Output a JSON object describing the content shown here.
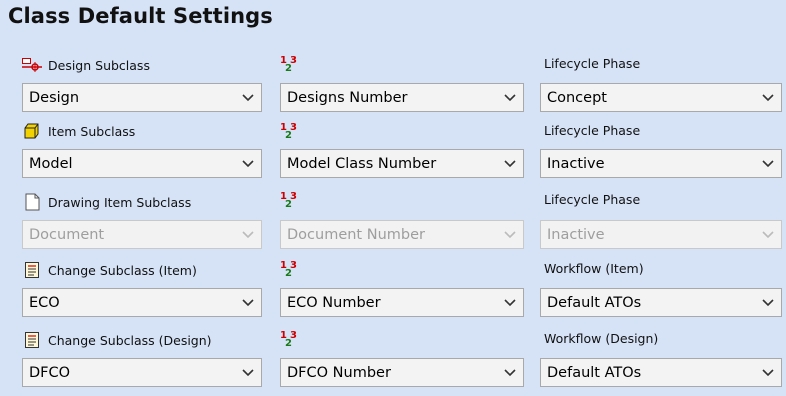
{
  "title": "Class Default Settings",
  "rows": [
    {
      "subclass_label": "Design Subclass",
      "subclass_icon": "design-subclass-icon",
      "subclass_value": "Design",
      "number_value": "Designs Number",
      "right_label": "Lifecycle Phase",
      "right_value": "Concept",
      "disabled": false
    },
    {
      "subclass_label": "Item Subclass",
      "subclass_icon": "item-cube-icon",
      "subclass_value": "Model",
      "number_value": "Model Class Number",
      "right_label": "Lifecycle Phase",
      "right_value": "Inactive",
      "disabled": false
    },
    {
      "subclass_label": "Drawing Item Subclass",
      "subclass_icon": "document-icon",
      "subclass_value": "Document",
      "number_value": "Document Number",
      "right_label": "Lifecycle Phase",
      "right_value": "Inactive",
      "disabled": true
    },
    {
      "subclass_label": "Change Subclass (Item)",
      "subclass_icon": "change-document-icon",
      "subclass_value": "ECO",
      "number_value": "ECO Number",
      "right_label": "Workflow (Item)",
      "right_value": "Default ATOs",
      "disabled": false
    },
    {
      "subclass_label": "Change Subclass (Design)",
      "subclass_icon": "change-document-icon",
      "subclass_value": "DFCO",
      "number_value": "DFCO Number",
      "right_label": "Workflow (Design)",
      "right_value": "Default ATOs",
      "disabled": false
    }
  ],
  "number_icon": "number-sequence-icon",
  "colors": {
    "background": "#d6e3f7",
    "dropdown_bg": "#f3f3f3",
    "dropdown_border": "#a9a9a9",
    "disabled_text": "#9e9e9e"
  }
}
